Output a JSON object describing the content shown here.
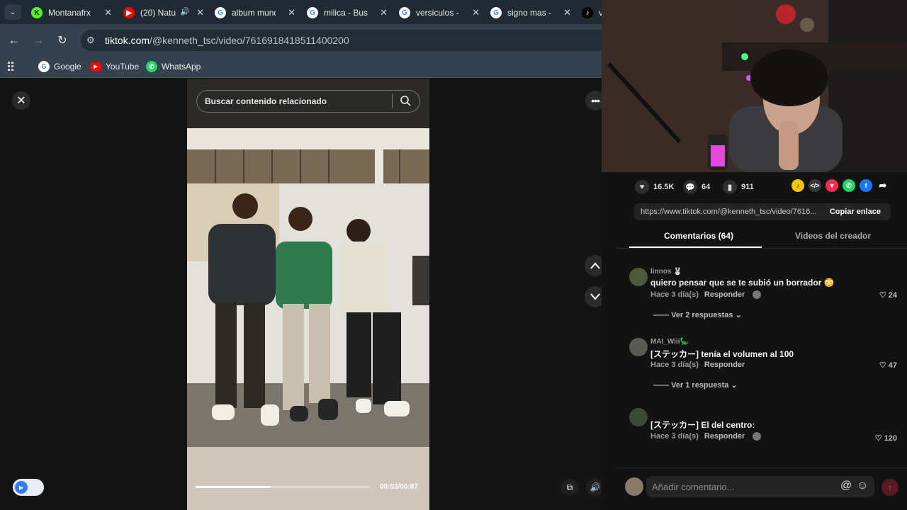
{
  "browser": {
    "tabs": [
      {
        "label": "Montanafrx",
        "icon": "K",
        "color": "#53fc18"
      },
      {
        "label": "(20) Natu",
        "icon": "▶",
        "color": "#ff0000"
      },
      {
        "label": "album mund",
        "icon": "G",
        "color": "#ffffff"
      },
      {
        "label": "milica - Busc",
        "icon": "G",
        "color": "#ffffff"
      },
      {
        "label": "versiculos - I",
        "icon": "G",
        "color": "#ffffff"
      },
      {
        "label": "signo mas -",
        "icon": "G",
        "color": "#ffffff"
      },
      {
        "label": "v",
        "icon": "♪",
        "color": "#000000"
      }
    ],
    "url_host": "tiktok.com",
    "url_path": "/@kenneth_tsc/video/7616918418511400200",
    "bookmarks": [
      {
        "label": "Google"
      },
      {
        "label": "YouTube"
      },
      {
        "label": "WhatsApp"
      }
    ]
  },
  "video": {
    "search_placeholder": "Buscar contenido relacionado",
    "time": "00:03/00:07",
    "progress": 0.43
  },
  "stats": {
    "likes": "16.5K",
    "comments": "64",
    "saves": "911"
  },
  "share": {
    "link": "https://www.tiktok.com/@kenneth_tsc/video/7616...",
    "copy_label": "Copiar enlace",
    "icons": [
      "bell-icon",
      "embed-icon",
      "send-icon",
      "whatsapp-icon",
      "facebook-icon",
      "share-arrow-icon"
    ]
  },
  "tabs": {
    "comments": "Comentarios (64)",
    "creator": "Videos del creador"
  },
  "comments": [
    {
      "user": "linnos 🐰",
      "text": "quiero pensar que se te subió un borrador 😳",
      "date": "Hace 3 día(s)",
      "reply": "Responder",
      "likes": "24",
      "replies": "Ver 2 respuestas"
    },
    {
      "user": "MAI_Wiii🦕",
      "text": "[ステッカー] tenía el volumen al 100",
      "date": "Hace 3 día(s)",
      "reply": "Responder",
      "likes": "47",
      "replies": "Ver 1 respuesta"
    },
    {
      "user": "",
      "text": "[ステッカー] El del centro:",
      "date": "Hace 3 día(s)",
      "reply": "Responder",
      "likes": "120",
      "replies": ""
    }
  ],
  "compose": {
    "placeholder": "Añadir comentario..."
  },
  "colors": {
    "accent": "#fe2c55",
    "panel": "#121212"
  }
}
